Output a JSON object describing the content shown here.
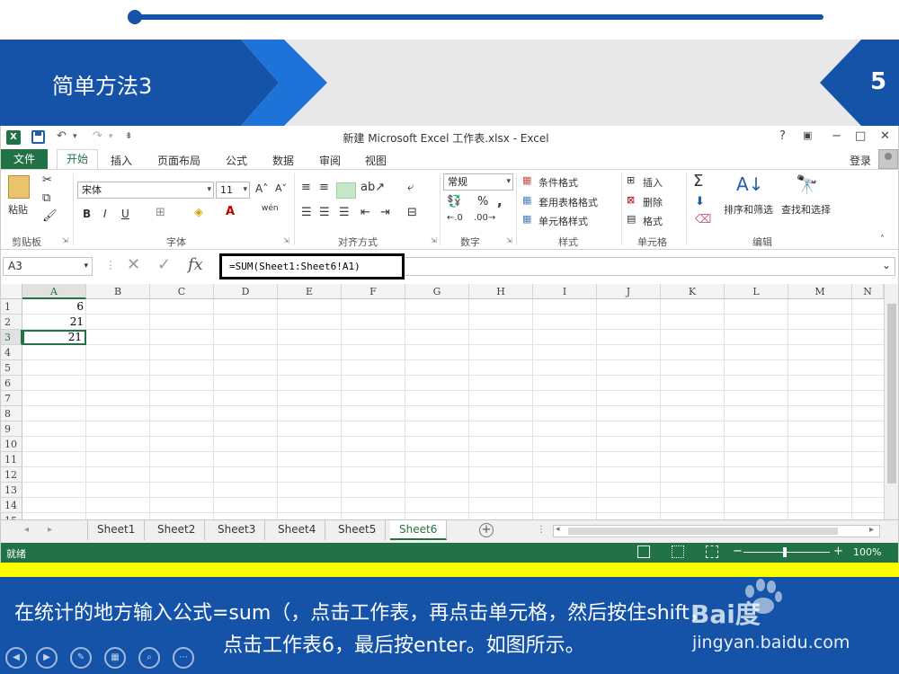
{
  "slide": {
    "title": "简单方法3",
    "page_number": "5",
    "progress": 1.0,
    "caption_line1": "在统计的地方输入公式=sum（，点击工作表，再点击单元格，然后按住shift，",
    "caption_line2": "点击工作表6，最后按enter。如图所示。",
    "watermark_logo": "Bai度",
    "watermark_url": "jingyan.baidu.com",
    "colors": {
      "banner": "#1553a8",
      "chevron": "#1e73d8",
      "highlight": "#ffff00",
      "excel_green": "#217346"
    }
  },
  "window": {
    "title": "新建 Microsoft Excel 工作表.xlsx - Excel",
    "help": "?",
    "controls": {
      "ribbon_display": "▣",
      "minimize": "−",
      "maximize": "□",
      "close": "✕"
    }
  },
  "quick_access": {
    "undo": "↶",
    "undo_menu": "▾",
    "redo": "↷",
    "redo_menu": "▾",
    "customize": "⇟"
  },
  "ribbon": {
    "file_tab": "文件",
    "tabs": [
      "开始",
      "插入",
      "页面布局",
      "公式",
      "数据",
      "审阅",
      "视图"
    ],
    "active_tab": "开始",
    "login": "登录",
    "clipboard": {
      "label": "剪贴板",
      "paste": "粘贴"
    },
    "font": {
      "label": "字体",
      "name": "宋体",
      "size": "11",
      "bold": "B",
      "italic": "I",
      "underline": "U",
      "grow": "A˄",
      "shrink": "A˅",
      "wen": "wén"
    },
    "alignment": {
      "label": "对齐方式"
    },
    "number": {
      "label": "数字",
      "format": "常规",
      "percent": "%",
      "comma": ","
    },
    "styles": {
      "label": "样式",
      "conditional": "条件格式",
      "table": "套用表格格式",
      "cell": "单元格样式"
    },
    "cells": {
      "label": "单元格",
      "insert": "插入",
      "delete": "删除",
      "format": "格式"
    },
    "editing": {
      "label": "编辑",
      "sort": "排序和筛选",
      "find": "查找和选择",
      "sigma": "Σ"
    }
  },
  "formula_bar": {
    "name_box": "A3",
    "fx": "fx",
    "formula": "=SUM(Sheet1:Sheet6!A1)"
  },
  "grid": {
    "columns": [
      "A",
      "B",
      "C",
      "D",
      "E",
      "F",
      "G",
      "H",
      "I",
      "J",
      "K",
      "L",
      "M",
      "N"
    ],
    "rows": [
      "1",
      "2",
      "3",
      "4",
      "5",
      "6",
      "7",
      "8",
      "9",
      "10",
      "11",
      "12",
      "13",
      "14",
      "15"
    ],
    "selected_column": "A",
    "selected_row": "3",
    "cells": [
      {
        "ref": "A1",
        "value": "6"
      },
      {
        "ref": "A2",
        "value": "21"
      },
      {
        "ref": "A3",
        "value": "21"
      }
    ]
  },
  "sheets": {
    "tabs": [
      "Sheet1",
      "Sheet2",
      "Sheet3",
      "Sheet4",
      "Sheet5",
      "Sheet6"
    ],
    "active": "Sheet6",
    "add": "+"
  },
  "status": {
    "ready": "就绪",
    "zoom": "100%",
    "zoom_minus": "−",
    "zoom_plus": "+"
  }
}
